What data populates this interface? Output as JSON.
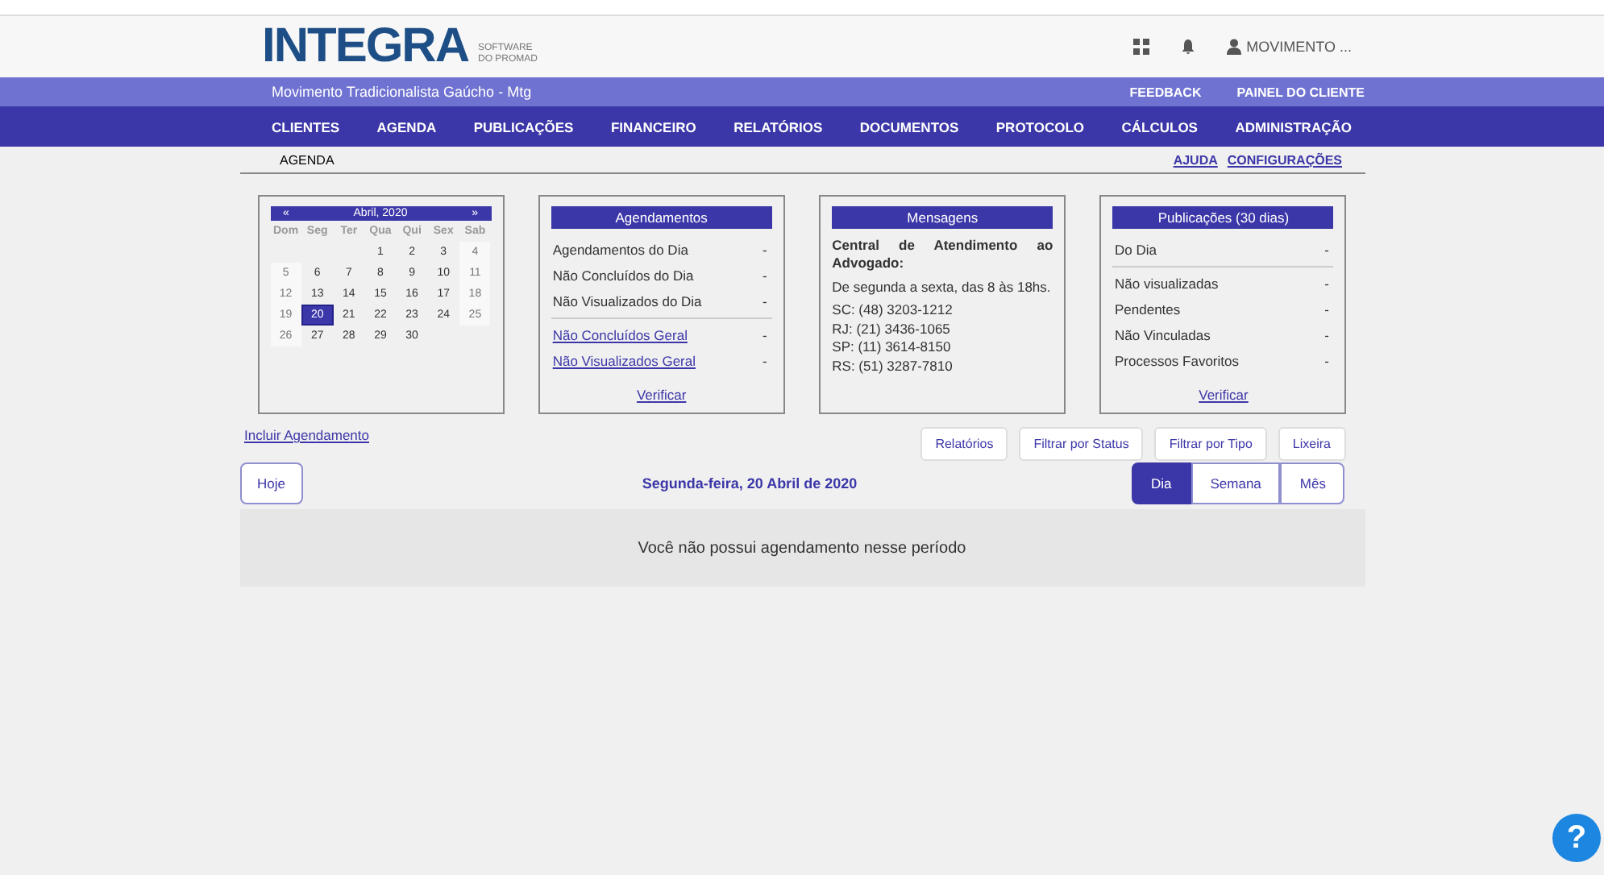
{
  "header": {
    "logo_main": "INTEGRA",
    "logo_sub": [
      "SOFTWARE",
      "DO PROMAD"
    ],
    "user": "MOVIMENTO ..."
  },
  "org_bar": {
    "name": "Movimento Tradicionalista Gaúcho - Mtg",
    "links": [
      "FEEDBACK",
      "PAINEL DO CLIENTE"
    ]
  },
  "nav": [
    "CLIENTES",
    "AGENDA",
    "PUBLICAÇÕES",
    "FINANCEIRO",
    "RELATÓRIOS",
    "DOCUMENTOS",
    "PROTOCOLO",
    "CÁLCULOS",
    "ADMINISTRAÇÃO"
  ],
  "breadcrumb": {
    "title": "AGENDA",
    "links": [
      "AJUDA",
      "CONFIGURAÇÕES"
    ]
  },
  "calendar": {
    "prev": "«",
    "title": "Abril, 2020",
    "next": "»",
    "weekdays": [
      "Dom",
      "Seg",
      "Ter",
      "Qua",
      "Qui",
      "Sex",
      "Sab"
    ],
    "weeks": [
      {
        "kind": "partial",
        "days": [
          {
            "d": "1",
            "selected": false
          },
          {
            "d": "2",
            "selected": false
          },
          {
            "d": "3",
            "selected": false
          },
          {
            "d": "4",
            "selected": false
          }
        ]
      },
      {
        "kind": "full",
        "days": [
          {
            "d": "5",
            "selected": false
          },
          {
            "d": "6",
            "selected": false
          },
          {
            "d": "7",
            "selected": false
          },
          {
            "d": "8",
            "selected": false
          },
          {
            "d": "9",
            "selected": false
          },
          {
            "d": "10",
            "selected": false
          },
          {
            "d": "11",
            "selected": false
          }
        ]
      },
      {
        "kind": "full",
        "days": [
          {
            "d": "12",
            "selected": false
          },
          {
            "d": "13",
            "selected": false
          },
          {
            "d": "14",
            "selected": false
          },
          {
            "d": "15",
            "selected": false
          },
          {
            "d": "16",
            "selected": false
          },
          {
            "d": "17",
            "selected": false
          },
          {
            "d": "18",
            "selected": false
          }
        ]
      },
      {
        "kind": "full",
        "days": [
          {
            "d": "19",
            "selected": false
          },
          {
            "d": "20",
            "selected": true
          },
          {
            "d": "21",
            "selected": false
          },
          {
            "d": "22",
            "selected": false
          },
          {
            "d": "23",
            "selected": false
          },
          {
            "d": "24",
            "selected": false
          },
          {
            "d": "25",
            "selected": false
          }
        ]
      },
      {
        "kind": "full",
        "days": [
          {
            "d": "26",
            "selected": false
          },
          {
            "d": "27",
            "selected": false
          },
          {
            "d": "28",
            "selected": false
          },
          {
            "d": "29",
            "selected": false
          },
          {
            "d": "30",
            "selected": false
          }
        ]
      }
    ]
  },
  "agendamentos": {
    "title": "Agendamentos",
    "rows": [
      {
        "label": "Agendamentos do Dia",
        "value": "-",
        "kind": "text"
      },
      {
        "label": "Não Concluídos do Dia",
        "value": "-",
        "kind": "text"
      },
      {
        "label": "Não Visualizados do Dia",
        "value": "-",
        "kind": "text"
      },
      {
        "label": "Não Concluídos Geral",
        "value": "-",
        "kind": "link"
      },
      {
        "label": "Não Visualizados Geral",
        "value": "-",
        "kind": "link"
      }
    ],
    "action": "Verificar"
  },
  "mensagens": {
    "title": "Mensagens",
    "heading": "Central de Atendimento ao Advogado:",
    "hours": "De segunda a sexta, das 8 às 18hs.",
    "phones": [
      "SC: (48) 3203-1212",
      "RJ: (21) 3436-1065",
      "SP: (11) 3614-8150",
      "RS: (51) 3287-7810"
    ]
  },
  "publicacoes": {
    "title": "Publicações (30 dias)",
    "rows": [
      {
        "label": "Do Dia",
        "value": "-"
      },
      {
        "label": "Não visualizadas",
        "value": "-"
      },
      {
        "label": "Pendentes",
        "value": "-"
      },
      {
        "label": "Não Vinculadas",
        "value": "-"
      },
      {
        "label": "Processos Favoritos",
        "value": "-"
      }
    ],
    "action": "Verificar"
  },
  "include_link": "Incluir Agendamento",
  "actions": [
    "Relatórios",
    "Filtrar por Status",
    "Filtrar por Tipo",
    "Lixeira"
  ],
  "today_button": "Hoje",
  "date": "Segunda-feira, 20 Abril de 2020",
  "views": [
    {
      "label": "Dia",
      "selected": true
    },
    {
      "label": "Semana",
      "selected": false
    },
    {
      "label": "Mês",
      "selected": false
    }
  ],
  "empty_message": "Você não possui agendamento nesse período",
  "help": "?"
}
